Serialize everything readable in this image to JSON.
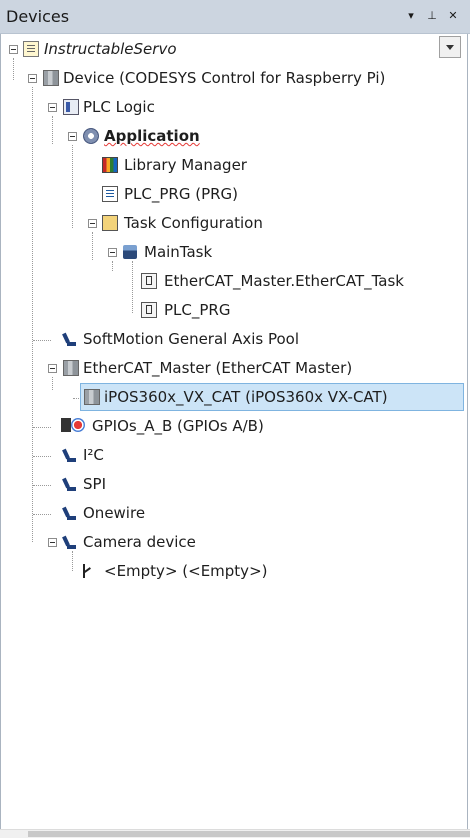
{
  "panel": {
    "title": "Devices"
  },
  "tree": [
    {
      "name": "project",
      "label": "InstructableServo",
      "icon": "project-icon"
    },
    {
      "name": "device",
      "label": "Device (CODESYS Control for Raspberry Pi)",
      "icon": "device-icon"
    },
    {
      "name": "plc-logic",
      "label": "PLC Logic",
      "icon": "plc-logic-icon"
    },
    {
      "name": "application",
      "label": "Application",
      "icon": "application-gear-icon"
    },
    {
      "name": "library-manager",
      "label": "Library Manager",
      "icon": "library-icon"
    },
    {
      "name": "plc-prg",
      "label": "PLC_PRG (PRG)",
      "icon": "program-icon"
    },
    {
      "name": "task-configuration",
      "label": "Task Configuration",
      "icon": "task-configuration-icon"
    },
    {
      "name": "main-task",
      "label": "MainTask",
      "icon": "task-icon"
    },
    {
      "name": "ethercat-task-call",
      "label": "EtherCAT_Master.EtherCAT_Task",
      "icon": "program-call-icon"
    },
    {
      "name": "plc-prg-call",
      "label": "PLC_PRG",
      "icon": "program-call-icon"
    },
    {
      "name": "softmotion-pool",
      "label": "SoftMotion General Axis Pool",
      "icon": "axis-icon"
    },
    {
      "name": "ethercat-master",
      "label": "EtherCAT_Master (EtherCAT Master)",
      "icon": "device-icon"
    },
    {
      "name": "ipos-drive",
      "label": "iPOS360x_VX_CAT (iPOS360x VX-CAT)",
      "icon": "device-icon"
    },
    {
      "name": "gpios",
      "label": "GPIOs_A_B (GPIOs A/B)",
      "icon": "gpio-icon"
    },
    {
      "name": "i2c",
      "label": "I²C",
      "icon": "axis-icon"
    },
    {
      "name": "spi",
      "label": "SPI",
      "icon": "axis-icon"
    },
    {
      "name": "onewire",
      "label": "Onewire",
      "icon": "axis-icon"
    },
    {
      "name": "camera-device",
      "label": "Camera device",
      "icon": "axis-icon"
    },
    {
      "name": "empty-slot",
      "label": "<Empty> (<Empty>)",
      "icon": "empty-slot-icon"
    }
  ],
  "colors": {
    "selection": "#cce4f7",
    "titlebar": "#ccd5e0"
  }
}
